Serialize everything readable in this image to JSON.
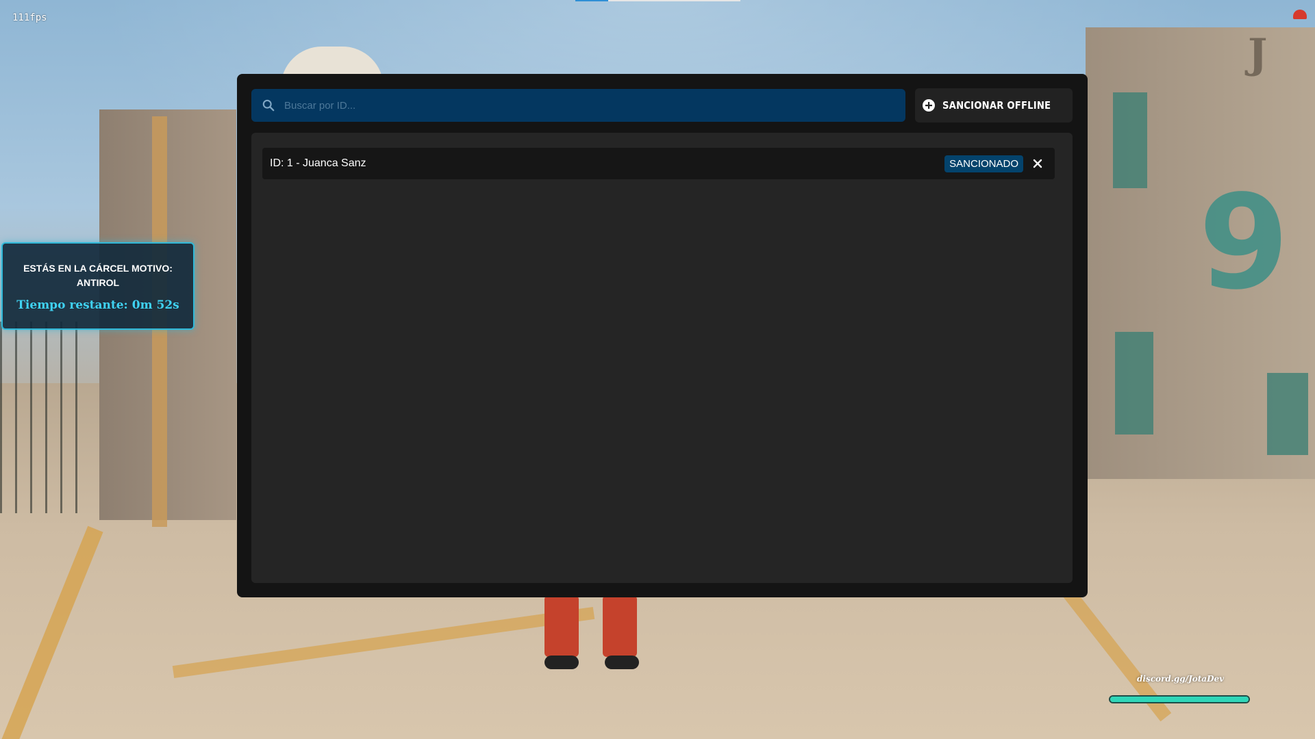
{
  "hud": {
    "fps": "111fps",
    "jail": {
      "title": "ESTÁS EN LA CÁRCEL MOTIVO: ANTIROL",
      "time_remaining": "Tiempo restante: 0m 52s"
    },
    "discord": "discord.gg/JotaDev",
    "status_bar_fill": 1.0
  },
  "panel": {
    "search": {
      "placeholder": "Buscar por ID...",
      "value": ""
    },
    "offline_button": {
      "label": "SANCIONAR OFFLINE",
      "icon": "plus-circle-icon"
    },
    "players": [
      {
        "label": "ID: 1 - Juanca Sanz",
        "badge": "SANCIONADO",
        "action_icon": "close-icon"
      }
    ]
  },
  "colors": {
    "panel_bg": "#141414",
    "list_bg": "#252525",
    "search_bg": "#043760",
    "badge_bg": "#04436c",
    "accent_cyan": "#3fd2f2",
    "hud_teal": "#2fd6b8"
  }
}
